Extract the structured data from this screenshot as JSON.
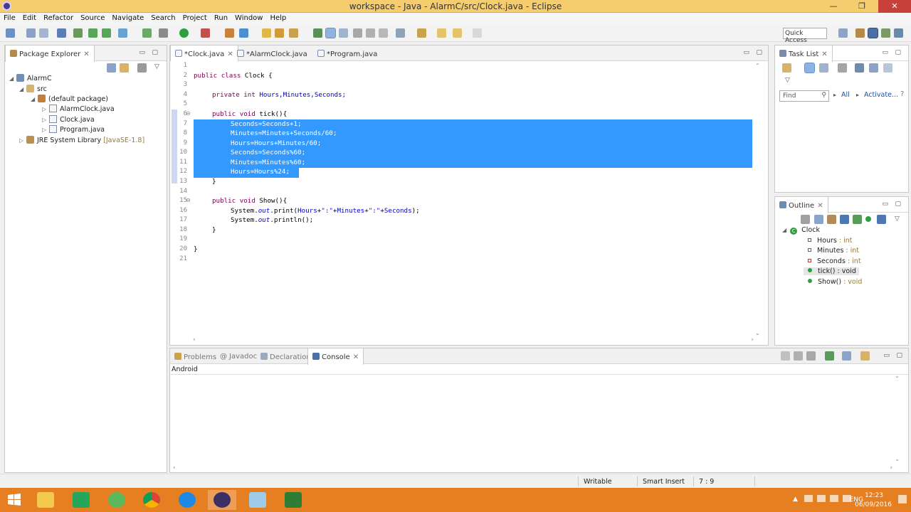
{
  "window": {
    "title": "workspace - Java - AlarmC/src/Clock.java - Eclipse",
    "min_glyph": "—",
    "max_glyph": "❐",
    "close_glyph": "✕"
  },
  "menu": [
    "File",
    "Edit",
    "Refactor",
    "Source",
    "Navigate",
    "Search",
    "Project",
    "Run",
    "Window",
    "Help"
  ],
  "toolbar": {
    "quick_access_placeholder": "Quick Access"
  },
  "package_explorer": {
    "tab_label": "Package Explorer",
    "tree": {
      "project": "AlarmC",
      "src": "src",
      "package": "(default package)",
      "files": [
        "AlarmClock.java",
        "Clock.java",
        "Program.java"
      ],
      "library": "JRE System Library",
      "library_version": "[JavaSE-1.8]"
    }
  },
  "editor": {
    "tabs": [
      "*Clock.java",
      "*AlarmClock.java",
      "*Program.java"
    ],
    "line_numbers": [
      "1",
      "2",
      "3",
      "4",
      "5",
      "6",
      "7",
      "8",
      "9",
      "10",
      "11",
      "12",
      "13",
      "14",
      "15",
      "16",
      "17",
      "18",
      "19",
      "20",
      "21"
    ],
    "code": {
      "l2_kw": "public class",
      "l2_rest": " Clock {",
      "l4_kw": "private int",
      "l4_fields": " Hours,Minutes,Seconds;",
      "l6_kw": "public void",
      "l6_rest": " tick(){",
      "l7": "Seconds=Seconds+1;",
      "l8": "Minutes=Minutes+Seconds/60;",
      "l9": "Hours=Hours+Minutes/60;",
      "l10": "Seconds=Seconds%60;",
      "l11": "Minutes=Minutes%60;",
      "l12": "Hours=Hours%24;",
      "l13": "}",
      "l15_kw": "public void",
      "l15_rest": " Show(){",
      "l16_a": "System.",
      "l16_b": "out",
      "l16_c": ".print(",
      "l16_d": "Hours",
      "l16_e": "+",
      "l16_f": "\":\"",
      "l16_g": "+",
      "l16_h": "Minutes",
      "l16_i": "+",
      "l16_j": "\":\"",
      "l16_k": "+",
      "l16_l": "Seconds",
      "l16_m": ");",
      "l17_a": "System.",
      "l17_b": "out",
      "l17_c": ".println();",
      "l18": "}",
      "l20": "}"
    }
  },
  "task_list": {
    "tab_label": "Task List",
    "find_placeholder": "Find",
    "all_label": "All",
    "activate_label": "Activate..."
  },
  "outline": {
    "tab_label": "Outline",
    "class_name": "Clock",
    "members": [
      {
        "name": "Hours",
        "type": " : int"
      },
      {
        "name": "Minutes",
        "type": " : int"
      },
      {
        "name": "Seconds",
        "type": " : int"
      },
      {
        "name": "tick()",
        "type": " : void"
      },
      {
        "name": "Show()",
        "type": " : void"
      }
    ]
  },
  "bottom_panel": {
    "tabs": [
      "Problems",
      "Javadoc",
      "Declaration",
      "Console"
    ],
    "console_label": "Android"
  },
  "status_bar": {
    "writable": "Writable",
    "insert_mode": "Smart Insert",
    "position": "7 : 9"
  },
  "taskbar": {
    "language": "ENG",
    "time": "12:23",
    "date": "06/09/2016"
  },
  "colors": {
    "title_bar": "#f5cd6f",
    "selection": "#3399ff",
    "keyword": "#7f0055",
    "field": "#0000c0",
    "string": "#2a00ff",
    "taskbar": "#e67e22"
  }
}
